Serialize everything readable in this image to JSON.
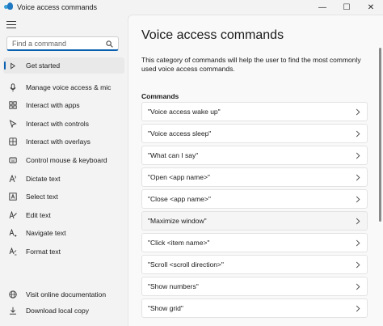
{
  "window": {
    "title": "Voice access commands",
    "minimize": "—",
    "maximize": "☐",
    "close": "✕"
  },
  "search": {
    "placeholder": "Find a command",
    "value": ""
  },
  "sidebar": {
    "items": [
      {
        "label": "Get started",
        "icon": "play-icon",
        "active": true
      },
      {
        "label": "Manage voice access & mic",
        "icon": "microphone-icon"
      },
      {
        "label": "Interact with apps",
        "icon": "apps-icon"
      },
      {
        "label": "Interact with controls",
        "icon": "cursor-icon"
      },
      {
        "label": "Interact with overlays",
        "icon": "overlay-grid-icon"
      },
      {
        "label": "Control mouse & keyboard",
        "icon": "mouse-icon"
      },
      {
        "label": "Dictate text",
        "icon": "dictate-icon"
      },
      {
        "label": "Select text",
        "icon": "select-text-icon"
      },
      {
        "label": "Edit text",
        "icon": "edit-icon"
      },
      {
        "label": "Navigate text",
        "icon": "navigate-icon"
      },
      {
        "label": "Format text",
        "icon": "format-icon"
      }
    ],
    "footer": [
      {
        "label": "Visit online documentation",
        "icon": "globe-icon"
      },
      {
        "label": "Download local copy",
        "icon": "download-icon"
      }
    ]
  },
  "main": {
    "title": "Voice access commands",
    "description": "This category of commands will help the user to find the most commonly used voice access commands.",
    "section_label": "Commands",
    "commands": [
      "\"Voice access wake up\"",
      "\"Voice access sleep\"",
      "\"What can I say\"",
      "\"Open <app name>\"",
      "\"Close <app name>\"",
      "\"Maximize window\"",
      "\"Click <item name>\"",
      "\"Scroll <scroll direction>\"",
      "\"Show numbers\"",
      "\"Show grid\""
    ]
  },
  "colors": {
    "accent": "#0a60b0",
    "background": "#f3f3f3",
    "card": "#ffffff"
  }
}
